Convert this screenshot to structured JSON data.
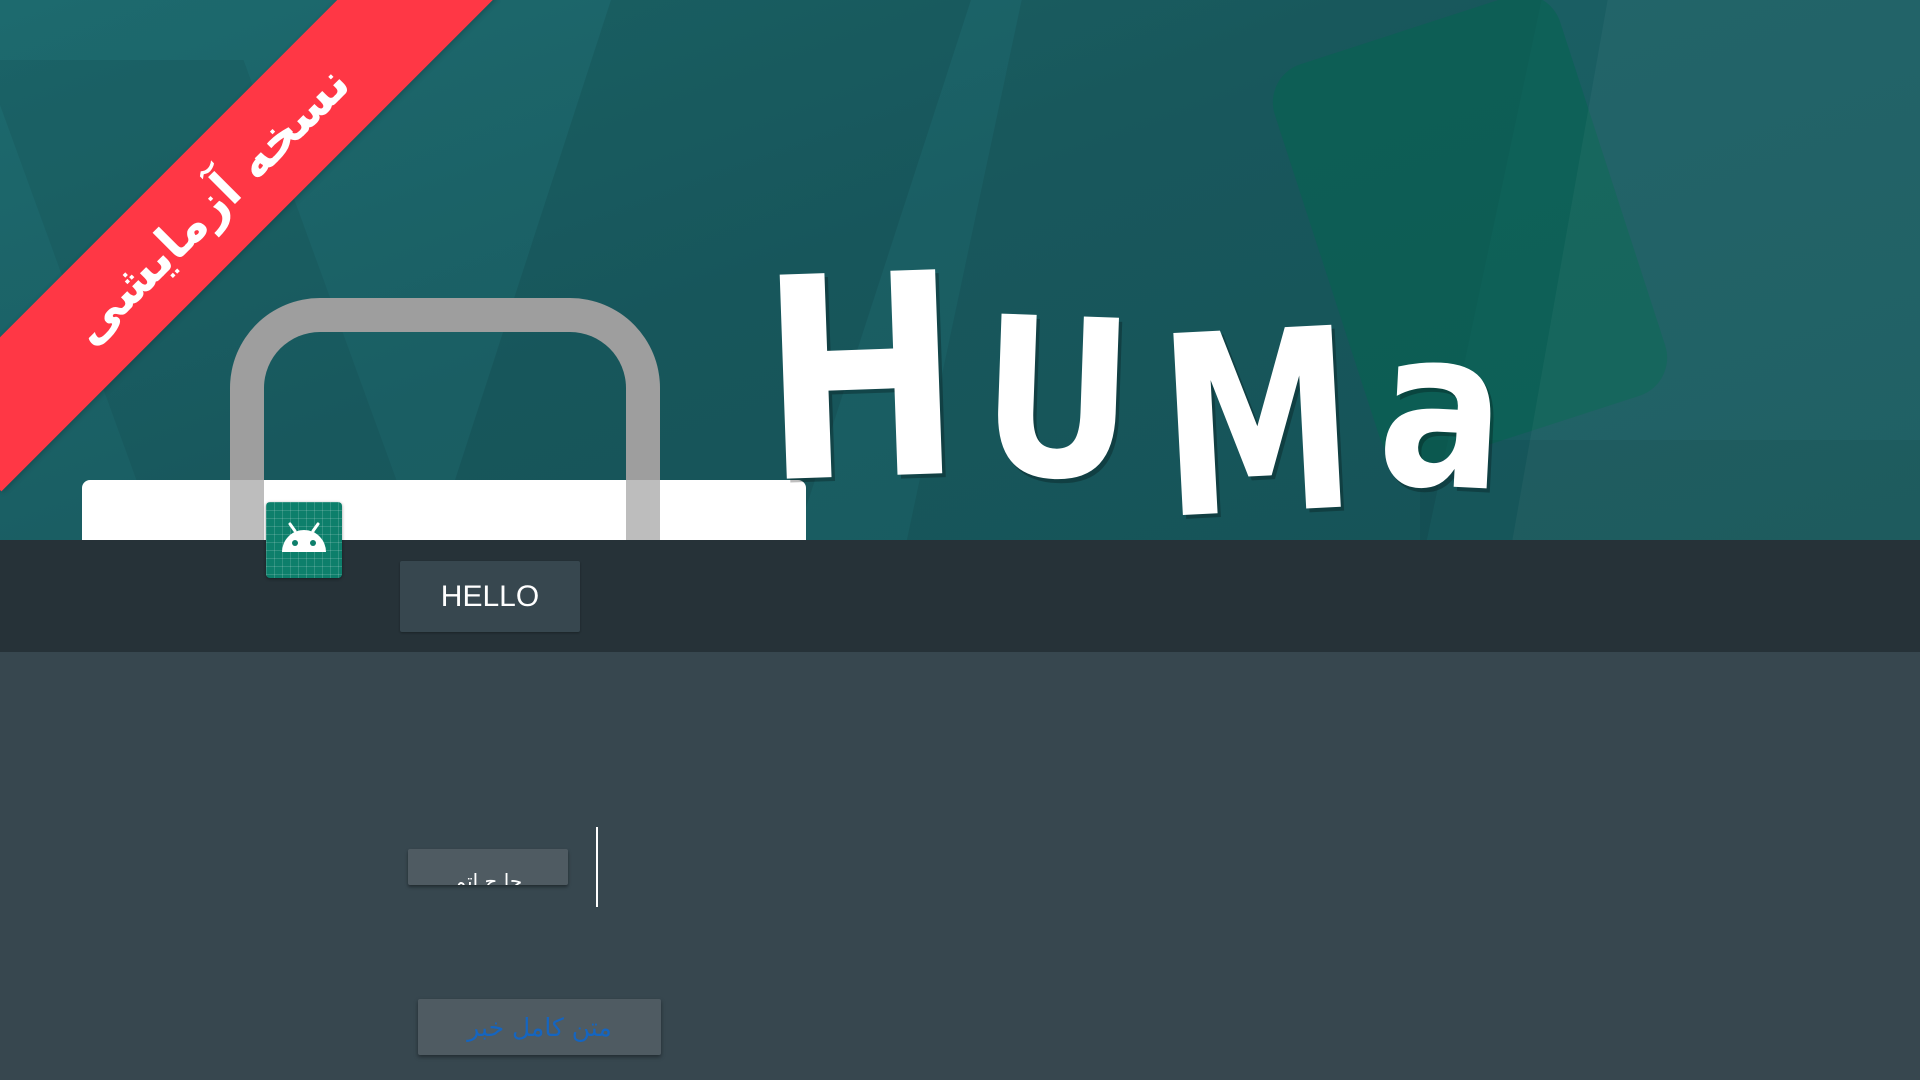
{
  "banner": {
    "ribbon_text": "نسخه آزمایشی",
    "logo": {
      "letters": [
        "H",
        "U",
        "M",
        "a"
      ]
    }
  },
  "toolbar": {
    "app_icon": "android-icon",
    "hello_label": "HELLO"
  },
  "content": {
    "chip_text": "جا ج اتم",
    "full_news_label": "متن کامل خبر"
  },
  "colors": {
    "ribbon": "#ff3745",
    "banner": "#1a5e63",
    "toolbar": "#263238",
    "background": "#37474f",
    "link": "#1565c0",
    "app_icon": "#0d7f6b"
  }
}
